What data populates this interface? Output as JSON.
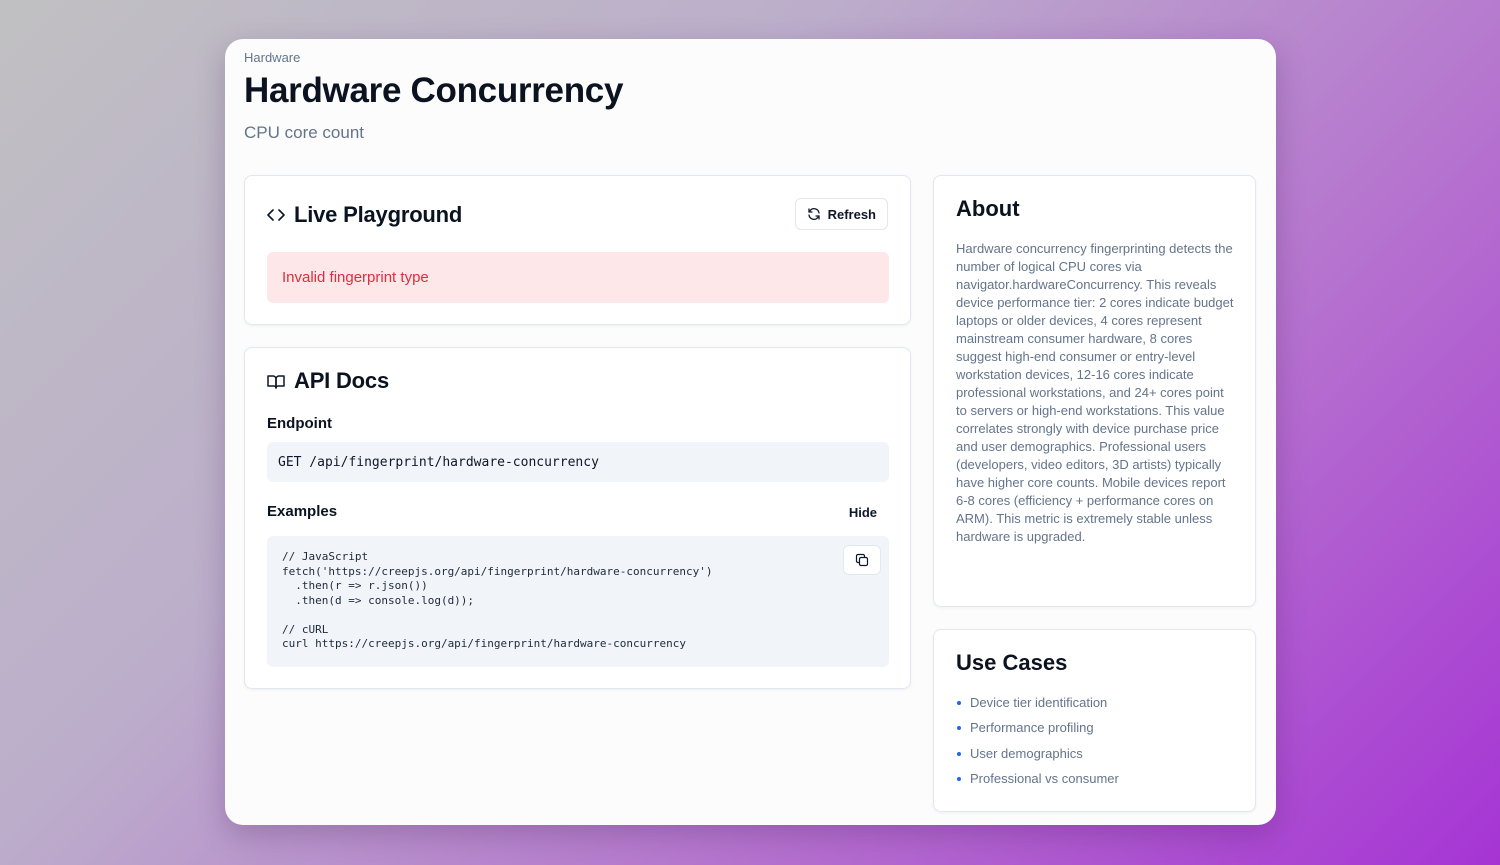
{
  "header": {
    "breadcrumb": "Hardware",
    "title": "Hardware Concurrency",
    "subtitle": "CPU core count"
  },
  "playground": {
    "title": "Live Playground",
    "icon": "code-icon",
    "refresh_label": "Refresh",
    "refresh_icon": "refresh-icon",
    "error": "Invalid fingerprint type"
  },
  "api_docs": {
    "title": "API Docs",
    "icon": "book-icon",
    "endpoint_label": "Endpoint",
    "endpoint": "GET /api/fingerprint/hardware-concurrency",
    "examples_label": "Examples",
    "hide_label": "Hide",
    "code_lines": [
      "// JavaScript",
      "fetch('https://creepjs.org/api/fingerprint/hardware-concurrency')",
      "  .then(r => r.json())",
      "  .then(d => console.log(d));",
      "",
      "// cURL",
      "curl https://creepjs.org/api/fingerprint/hardware-concurrency"
    ],
    "copy_icon": "copy-icon"
  },
  "about": {
    "title": "About",
    "text": "Hardware concurrency fingerprinting detects the number of logical CPU cores via navigator.hardwareConcurrency. This reveals device performance tier: 2 cores indicate budget laptops or older devices, 4 cores represent mainstream consumer hardware, 8 cores suggest high-end consumer or entry-level workstation devices, 12-16 cores indicate professional workstations, and 24+ cores point to servers or high-end workstations. This value correlates strongly with device purchase price and user demographics. Professional users (developers, video editors, 3D artists) typically have higher core counts. Mobile devices report 6-8 cores (efficiency + performance cores on ARM). This metric is extremely stable unless hardware is upgraded."
  },
  "use_cases": {
    "title": "Use Cases",
    "items": [
      "Device tier identification",
      "Performance profiling",
      "User demographics",
      "Professional vs consumer"
    ]
  },
  "colors": {
    "accent": "#2563eb",
    "error_text": "#dc2f3c",
    "error_bg": "#fee7e9",
    "muted_text": "#64748b"
  }
}
